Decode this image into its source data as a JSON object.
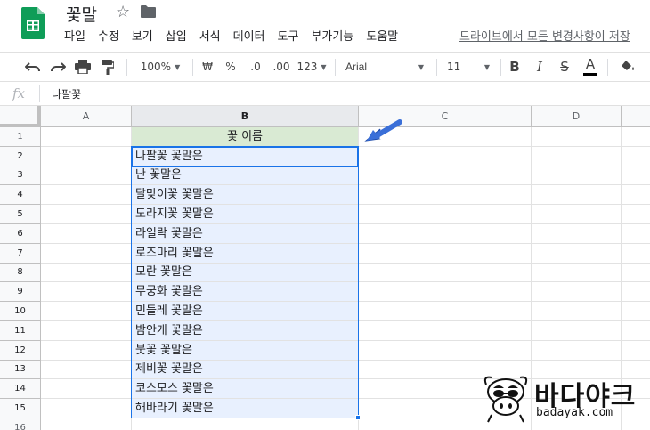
{
  "app": {
    "doc_title": "꽃말",
    "menu": [
      "파일",
      "수정",
      "보기",
      "삽입",
      "서식",
      "데이터",
      "도구",
      "부가기능",
      "도움말"
    ],
    "save_status": "드라이브에서 모든 변경사항이 저장"
  },
  "toolbar": {
    "zoom": "100%",
    "currency": "₩",
    "percent": "%",
    "dec_decrease": ".0",
    "dec_increase": ".00",
    "number_format": "123",
    "font": "Arial",
    "font_size": "11",
    "bold": "B",
    "italic": "I",
    "strike": "S",
    "text_color": "A"
  },
  "formula_bar": {
    "icon_text": "fx",
    "content": "나팔꽃"
  },
  "grid": {
    "columns": [
      "A",
      "B",
      "C",
      "D"
    ],
    "rows": [
      "1",
      "2",
      "3",
      "4",
      "5",
      "6",
      "7",
      "8",
      "9",
      "10",
      "11",
      "12",
      "13",
      "14",
      "15",
      "16"
    ],
    "header_cell": "꽃 이름",
    "values": [
      "나팔꽃 꽃말은",
      "난 꽃말은",
      "달맞이꽃 꽃말은",
      "도라지꽃 꽃말은",
      "라일락 꽃말은",
      "로즈마리 꽃말은",
      "모란 꽃말은",
      "무궁화 꽃말은",
      "민들레 꽃말은",
      "밤안개 꽃말은",
      "붓꽃 꽃말은",
      "제비꽃 꽃말은",
      "코스모스 꽃말은",
      "해바라기 꽃말은"
    ]
  },
  "watermark": {
    "text": "바다야크",
    "url": "badayak.com"
  },
  "colors": {
    "accent": "#1a73e8",
    "header_fill": "#d9ead3",
    "range_fill": "#e8f0fe",
    "sheets_green": "#0f9d58",
    "annotation_arrow": "#3a6fd8"
  }
}
